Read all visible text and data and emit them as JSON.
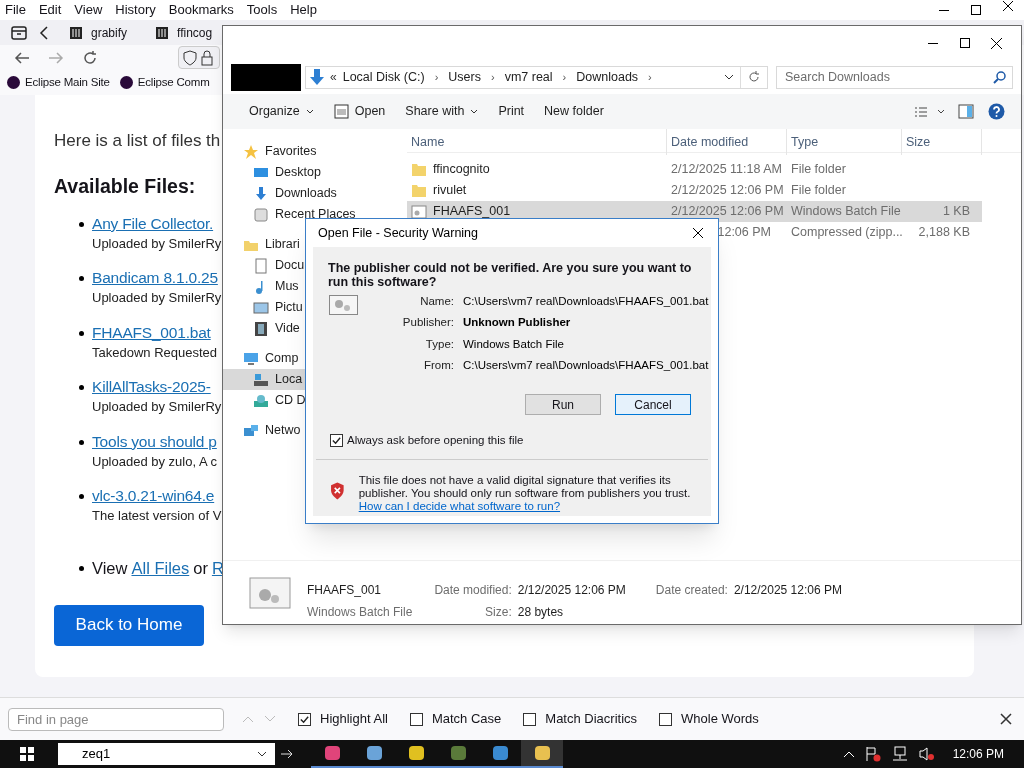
{
  "browser": {
    "menu": [
      "File",
      "Edit",
      "View",
      "History",
      "Bookmarks",
      "Tools",
      "Help"
    ],
    "tabs": [
      {
        "label": "grabify",
        "selected": false
      },
      {
        "label": "ffincog",
        "selected": false
      }
    ],
    "bookmarks": [
      "Eclipse Main Site",
      "Eclipse Comm"
    ],
    "page": {
      "intro": "Here is a list of files th",
      "heading": "Available Files:",
      "files": [
        {
          "link": "Any File Collector.",
          "note": "Uploaded by SmilerRy"
        },
        {
          "link": "Bandicam 8.1.0.25",
          "note": "Uploaded by SmilerRy"
        },
        {
          "link": "FHAAFS_001.bat",
          "note": "Takedown Requested"
        },
        {
          "link": "KillAllTasks-2025-",
          "note": "Uploaded by SmilerRy"
        },
        {
          "link": "Tools you should p",
          "note": "Uploaded by zulo, A c"
        },
        {
          "link": "vlc-3.0.21-win64.e",
          "note": "The latest version of V"
        }
      ],
      "footer": {
        "prefix": "View",
        "link1": "All Files",
        "middle": "or",
        "link2": "R"
      },
      "button": "Back to Home"
    },
    "find_bar": {
      "placeholder": "Find in page",
      "options": [
        {
          "label": "Highlight All",
          "checked": true
        },
        {
          "label": "Match Case",
          "checked": false
        },
        {
          "label": "Match Diacritics",
          "checked": false
        },
        {
          "label": "Whole Words",
          "checked": false
        }
      ]
    }
  },
  "explorer": {
    "path_overflow": "«",
    "path_separator": "›",
    "path": [
      "Local Disk (C:)",
      "Users",
      "vm7 real",
      "Downloads"
    ],
    "search_placeholder": "Search Downloads",
    "toolbar": [
      {
        "label": "Organize",
        "kind": "menu"
      },
      {
        "label": "Open",
        "kind": "icon"
      },
      {
        "label": "Share with",
        "kind": "menu"
      },
      {
        "label": "Print",
        "kind": "plain"
      },
      {
        "label": "New folder",
        "kind": "plain"
      }
    ],
    "nav": [
      {
        "label": "Favorites",
        "kind": "star",
        "selected": false,
        "children": [
          {
            "label": "Desktop",
            "kind": "desktop",
            "selected": false
          },
          {
            "label": "Downloads",
            "kind": "download",
            "selected": false
          },
          {
            "label": "Recent Places",
            "kind": "recent",
            "selected": false
          }
        ]
      },
      {
        "label": "Librari",
        "kind": "library",
        "selected": false,
        "children": [
          {
            "label": "Docu",
            "kind": "document",
            "selected": false
          },
          {
            "label": "Mus",
            "kind": "music",
            "selected": false
          },
          {
            "label": "Pictu",
            "kind": "picture",
            "selected": false
          },
          {
            "label": "Vide",
            "kind": "video",
            "selected": false
          }
        ]
      },
      {
        "label": "Comp",
        "kind": "computer",
        "selected": false,
        "children": [
          {
            "label": "Loca",
            "kind": "disk",
            "selected": true
          },
          {
            "label": "CD D",
            "kind": "cd",
            "selected": false
          }
        ]
      },
      {
        "label": "Netwo",
        "kind": "network",
        "selected": false
      }
    ],
    "columns": [
      "Name",
      "Date modified",
      "Type",
      "Size"
    ],
    "rows": [
      {
        "kind": "folder",
        "name": "ffincognito",
        "date": "2/12/2025 11:18 AM",
        "type": "File folder",
        "selected": false
      },
      {
        "kind": "folder",
        "name": "rivulet",
        "date": "2/12/2025 12:06 PM",
        "type": "File folder",
        "selected": false
      },
      {
        "kind": "batch",
        "name": "FHAAFS_001",
        "date": "2/12/2025 12:06 PM",
        "type": "Windows Batch File",
        "size": "1 KB",
        "selected": true
      },
      {
        "kind": "hidden",
        "date": "12:06 PM",
        "type": "Compressed (zipp...",
        "size": "2,188 KB",
        "selected": false
      }
    ],
    "details": {
      "name": "FHAAFS_001",
      "type": "Windows Batch File",
      "fields": [
        {
          "label": "Date modified:",
          "value": "2/12/2025 12:06 PM"
        },
        {
          "label": "Size:",
          "value": "28 bytes"
        },
        {
          "label": "Date created:",
          "value": "2/12/2025 12:06 PM"
        }
      ]
    }
  },
  "dialog": {
    "title": "Open File - Security Warning",
    "question": "The publisher could not be verified.  Are you sure you want to run this software?",
    "fields": [
      {
        "label": "Name:",
        "value": "C:\\Users\\vm7 real\\Downloads\\FHAAFS_001.bat",
        "bold": false
      },
      {
        "label": "Publisher:",
        "value": "Unknown Publisher",
        "bold": true
      },
      {
        "label": "Type:",
        "value": "Windows Batch File",
        "bold": false
      },
      {
        "label": "From:",
        "value": "C:\\Users\\vm7 real\\Downloads\\FHAAFS_001.bat",
        "bold": false
      }
    ],
    "buttons": [
      {
        "label": "Run",
        "focused": false
      },
      {
        "label": "Cancel",
        "focused": true
      }
    ],
    "always_ask": {
      "label": "Always ask before opening this file",
      "checked": true
    },
    "warning": "This file does not have a valid digital signature that verifies its publisher.  You should only run software from publishers you trust.",
    "link": "How can I decide what software to run?"
  },
  "taskbar": {
    "search_value": "zeq1",
    "time": "12:06 PM"
  }
}
